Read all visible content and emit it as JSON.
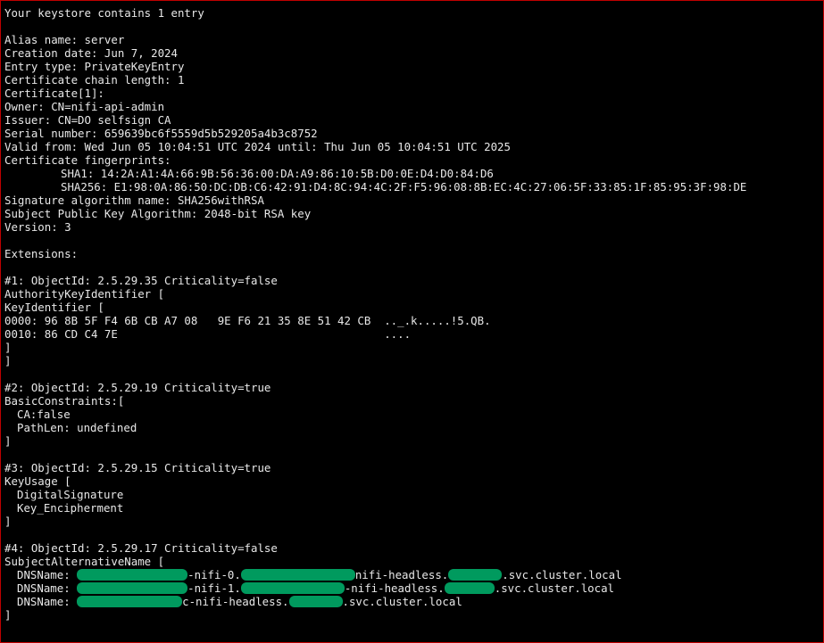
{
  "terminal": {
    "header": "Your keystore contains 1 entry",
    "alias": "Alias name: server",
    "creation_date": "Creation date: Jun 7, 2024",
    "entry_type": "Entry type: PrivateKeyEntry",
    "chain_length": "Certificate chain length: 1",
    "cert_index": "Certificate[1]:",
    "owner": "Owner: CN=nifi-api-admin",
    "issuer": "Issuer: CN=DO selfsign CA",
    "serial": "Serial number: 659639bc6f5559d5b529205a4b3c8752",
    "valid": "Valid from: Wed Jun 05 10:04:51 UTC 2024 until: Thu Jun 05 10:04:51 UTC 2025",
    "fingerprints_label": "Certificate fingerprints:",
    "sha1": "SHA1: 14:2A:A1:4A:66:9B:56:36:00:DA:A9:86:10:5B:D0:0E:D4:D0:84:D6",
    "sha256": "SHA256: E1:98:0A:86:50:DC:DB:C6:42:91:D4:8C:94:4C:2F:F5:96:08:8B:EC:4C:27:06:5F:33:85:1F:85:95:3F:98:DE",
    "sig_alg": "Signature algorithm name: SHA256withRSA",
    "pubkey_alg": "Subject Public Key Algorithm: 2048-bit RSA key",
    "version": "Version: 3",
    "extensions_label": "Extensions:",
    "ext1": {
      "header": "#1: ObjectId: 2.5.29.35 Criticality=false",
      "name": "AuthorityKeyIdentifier [",
      "sub": "KeyIdentifier [",
      "hex0": "0000: 96 8B 5F F4 6B CB A7 08   9E F6 21 35 8E 51 42 CB  .._.k.....!5.QB.",
      "hex1": "0010: 86 CD C4 7E                                        ....",
      "close_inner": "]",
      "close_outer": "]"
    },
    "ext2": {
      "header": "#2: ObjectId: 2.5.29.19 Criticality=true",
      "name": "BasicConstraints:[",
      "ca": "CA:false",
      "pathlen": "PathLen: undefined",
      "close": "]"
    },
    "ext3": {
      "header": "#3: ObjectId: 2.5.29.15 Criticality=true",
      "name": "KeyUsage [",
      "u1": "DigitalSignature",
      "u2": "Key_Encipherment",
      "close": "]"
    },
    "ext4": {
      "header": "#4: ObjectId: 2.5.29.17 Criticality=false",
      "name": "SubjectAlternativeName [",
      "dns_prefix": "DNSName: ",
      "dns1_a": "-nifi-0.",
      "dns1_b": "nifi-headless.",
      "dns1_c": ".svc.cluster.local",
      "dns2_a": "-nifi-1.",
      "dns2_b": "-nifi-headless.",
      "dns2_c": ".svc.cluster.local",
      "dns3_a": "c-nifi-headless.",
      "dns3_b": ".svc.cluster.local",
      "close": "]"
    },
    "redaction_color": "#009a5e",
    "text_color": "#e8e8e8",
    "border_color": "#c00000"
  }
}
